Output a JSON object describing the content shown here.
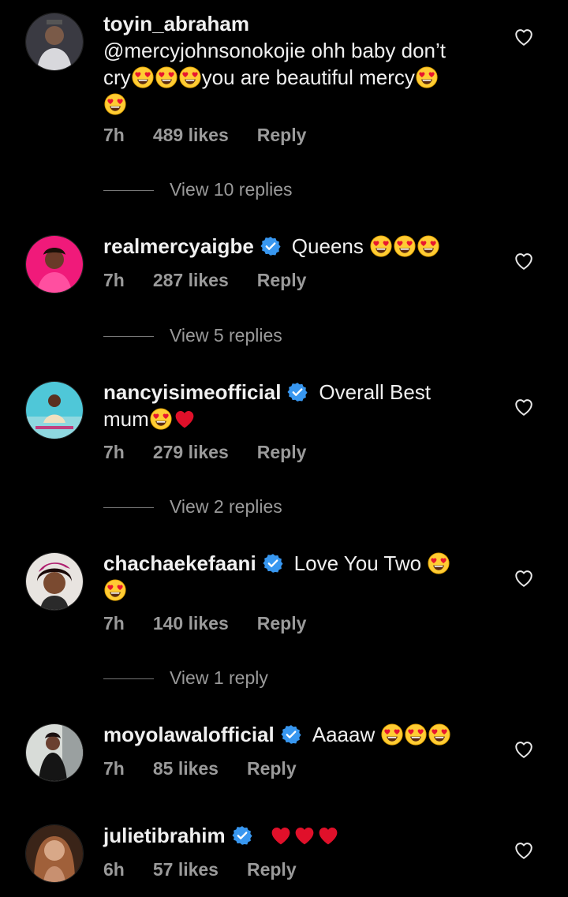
{
  "comments": [
    {
      "username": "toyin_abraham",
      "verified": false,
      "text_lines": [
        "@mercyjohnsonokojie ohh baby don’t",
        "cry",
        "you are beautiful mercy"
      ],
      "time": "7h",
      "likes": "489 likes",
      "reply": "Reply",
      "view_replies": "View 10 replies"
    },
    {
      "username": "realmercyaigbe",
      "verified": true,
      "text": "Queens",
      "time": "7h",
      "likes": "287 likes",
      "reply": "Reply",
      "view_replies": "View 5 replies"
    },
    {
      "username": "nancyisimeofficial",
      "verified": true,
      "text": "Overall Best",
      "text2": "mum",
      "time": "7h",
      "likes": "279 likes",
      "reply": "Reply",
      "view_replies": "View 2 replies"
    },
    {
      "username": "chachaekefaani",
      "verified": true,
      "text": "Love You Two",
      "time": "7h",
      "likes": "140 likes",
      "reply": "Reply",
      "view_replies": "View 1 reply"
    },
    {
      "username": "moyolawalofficial",
      "verified": true,
      "text": "Aaaaw",
      "time": "7h",
      "likes": "85 likes",
      "reply": "Reply"
    },
    {
      "username": "julietibrahim",
      "verified": true,
      "text": "",
      "time": "6h",
      "likes": "57 likes",
      "reply": "Reply"
    }
  ],
  "icons": {
    "like": "heart-outline-icon",
    "verified": "verified-badge-icon",
    "heart_eyes": "heart-eyes-emoji",
    "red_heart": "red-heart-emoji"
  },
  "colors": {
    "background": "#000000",
    "verified": "#3897f0",
    "meta": "#9a9a9a",
    "red_heart": "#e0102a"
  }
}
